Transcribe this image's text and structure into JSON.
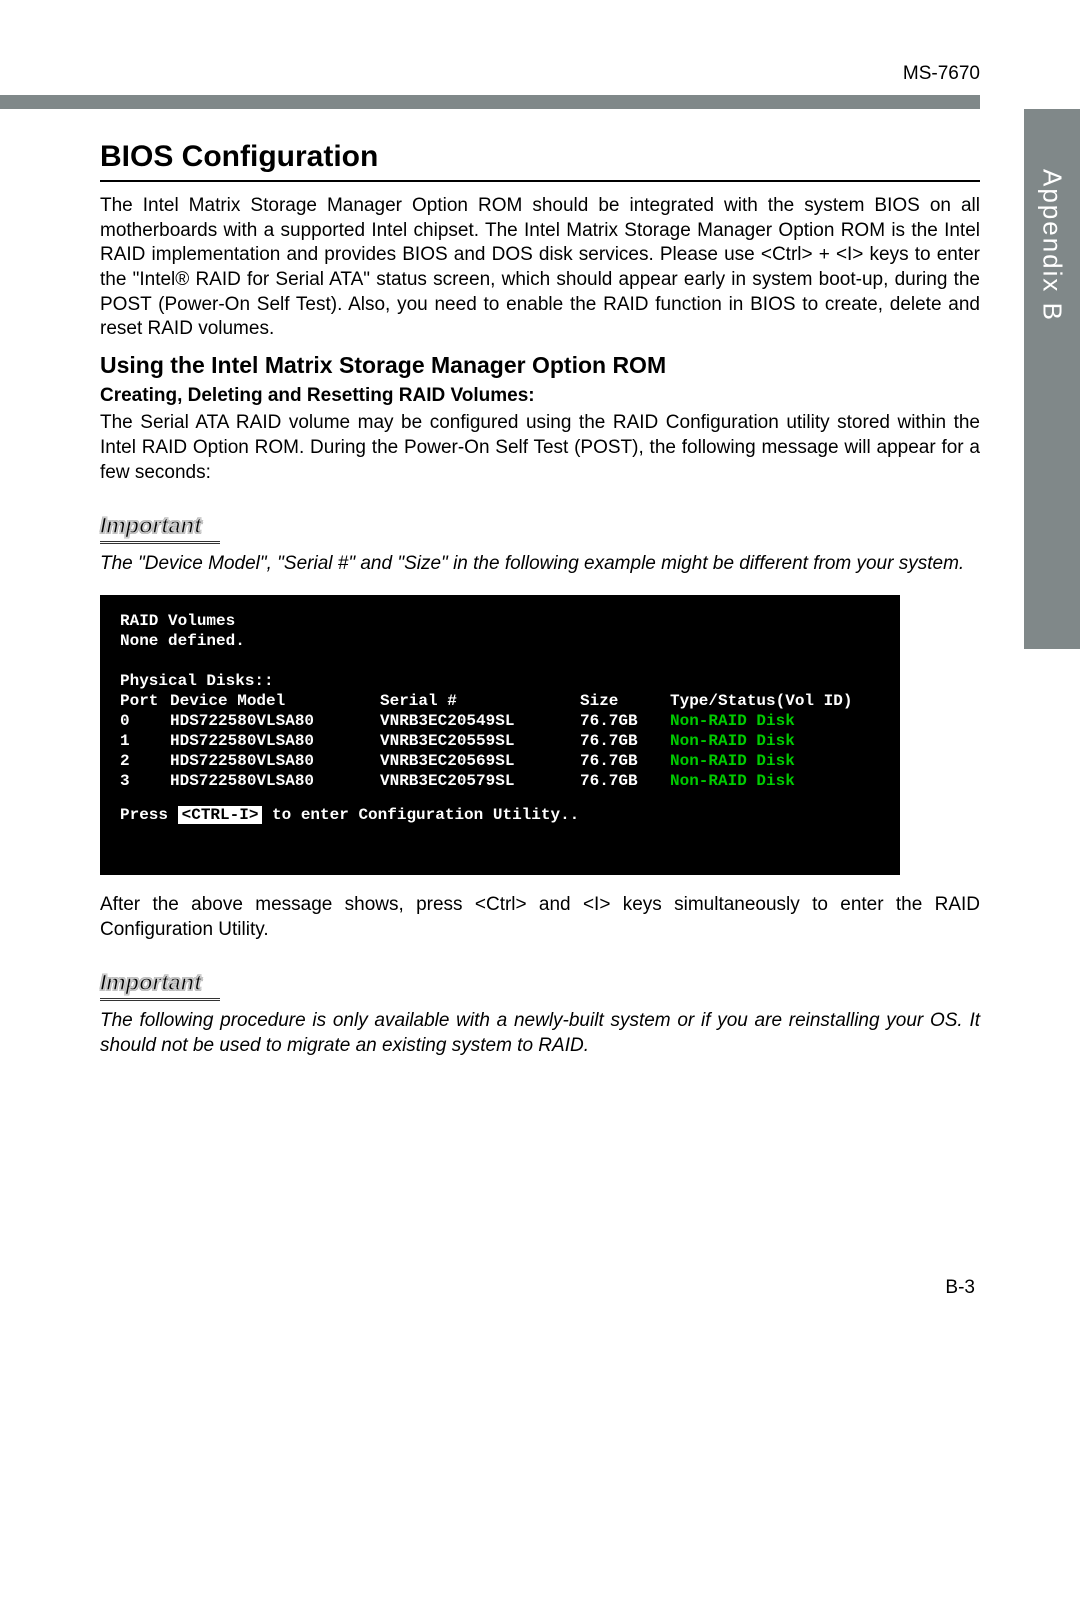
{
  "header": {
    "model": "MS-7670"
  },
  "sidebar": {
    "label": "Appendix B"
  },
  "title": "BIOS Configuration",
  "intro": "The Intel Matrix Storage Manager Option ROM should be integrated with the system BIOS on all motherboards with a supported Intel chipset. The Intel Matrix Storage Manager Option ROM is the Intel RAID implementation and provides BIOS and DOS disk services. Please use <Ctrl> + <I> keys to enter the \"Intel® RAID for Serial ATA\" status screen, which should  appear early in system boot-up, during the POST (Power-On Self Test). Also, you need to enable the RAID function in BIOS to create, delete and reset RAID volumes.",
  "subtitle": "Using the Intel Matrix Storage Manager Option ROM",
  "subsub": "Creating, Deleting and Resetting RAID Volumes:",
  "para2": "The Serial ATA RAID volume may be configured using the RAID Configuration utility stored within the Intel RAID Option ROM. During the Power-On Self Test (POST), the following message will appear for a few seconds:",
  "important1": {
    "label": "Important",
    "text": "The \"Device Model\", \"Serial #\" and \"Size\" in the following example might be different from your system."
  },
  "bios": {
    "raid_title": "RAID Volumes",
    "raid_status": "None defined.",
    "phys_title": "Physical Disks::",
    "columns": {
      "port": "Port",
      "model": "Device Model",
      "serial": "Serial #",
      "size": "Size",
      "status": "Type/Status(Vol ID)"
    },
    "rows": [
      {
        "port": "0",
        "model": "HDS722580VLSA80",
        "serial": "VNRB3EC20549SL",
        "size": "76.7GB",
        "status": "Non-RAID Disk"
      },
      {
        "port": "1",
        "model": "HDS722580VLSA80",
        "serial": "VNRB3EC20559SL",
        "size": "76.7GB",
        "status": "Non-RAID Disk"
      },
      {
        "port": "2",
        "model": "HDS722580VLSA80",
        "serial": "VNRB3EC20569SL",
        "size": "76.7GB",
        "status": "Non-RAID Disk"
      },
      {
        "port": "3",
        "model": "HDS722580VLSA80",
        "serial": "VNRB3EC20579SL",
        "size": "76.7GB",
        "status": "Non-RAID Disk"
      }
    ],
    "press_pre": "Press ",
    "press_key": "<CTRL-I>",
    "press_post": " to enter Configuration Utility.."
  },
  "para3": "After the above message shows, press <Ctrl> and <I> keys simultaneously to enter the RAID Configuration Utility.",
  "important2": {
    "label": "Important",
    "text": "The following procedure is only available with a newly-built system or if you are reinstalling your OS. It should not be used to migrate an existing system to RAID."
  },
  "page_number": "B-3"
}
